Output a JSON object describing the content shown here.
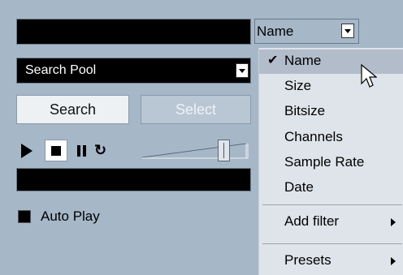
{
  "sort_select": {
    "value": "Name"
  },
  "scope_select": {
    "value": "Search Pool"
  },
  "buttons": {
    "search": "Search",
    "select": "Select"
  },
  "auto_play": {
    "label": "Auto Play",
    "checked": true
  },
  "dropdown_menu": {
    "items": [
      {
        "label": "Name",
        "checked": true,
        "highlighted": true
      },
      {
        "label": "Size"
      },
      {
        "label": "Bitsize"
      },
      {
        "label": "Channels"
      },
      {
        "label": "Sample Rate"
      },
      {
        "label": "Date"
      },
      {
        "label": "Add filter",
        "submenu": true
      },
      {
        "label": "Presets",
        "submenu": true
      }
    ]
  },
  "icons": {
    "play": "play-icon",
    "stop": "stop-icon",
    "pause": "pause-icon",
    "loop": "loop-icon",
    "check": "checkmark-icon",
    "cursor": "mouse-pointer-icon"
  },
  "colors": {
    "panel": "#a6b7c8",
    "menu": "#dfe4ea",
    "highlight": "#b2bccb"
  }
}
